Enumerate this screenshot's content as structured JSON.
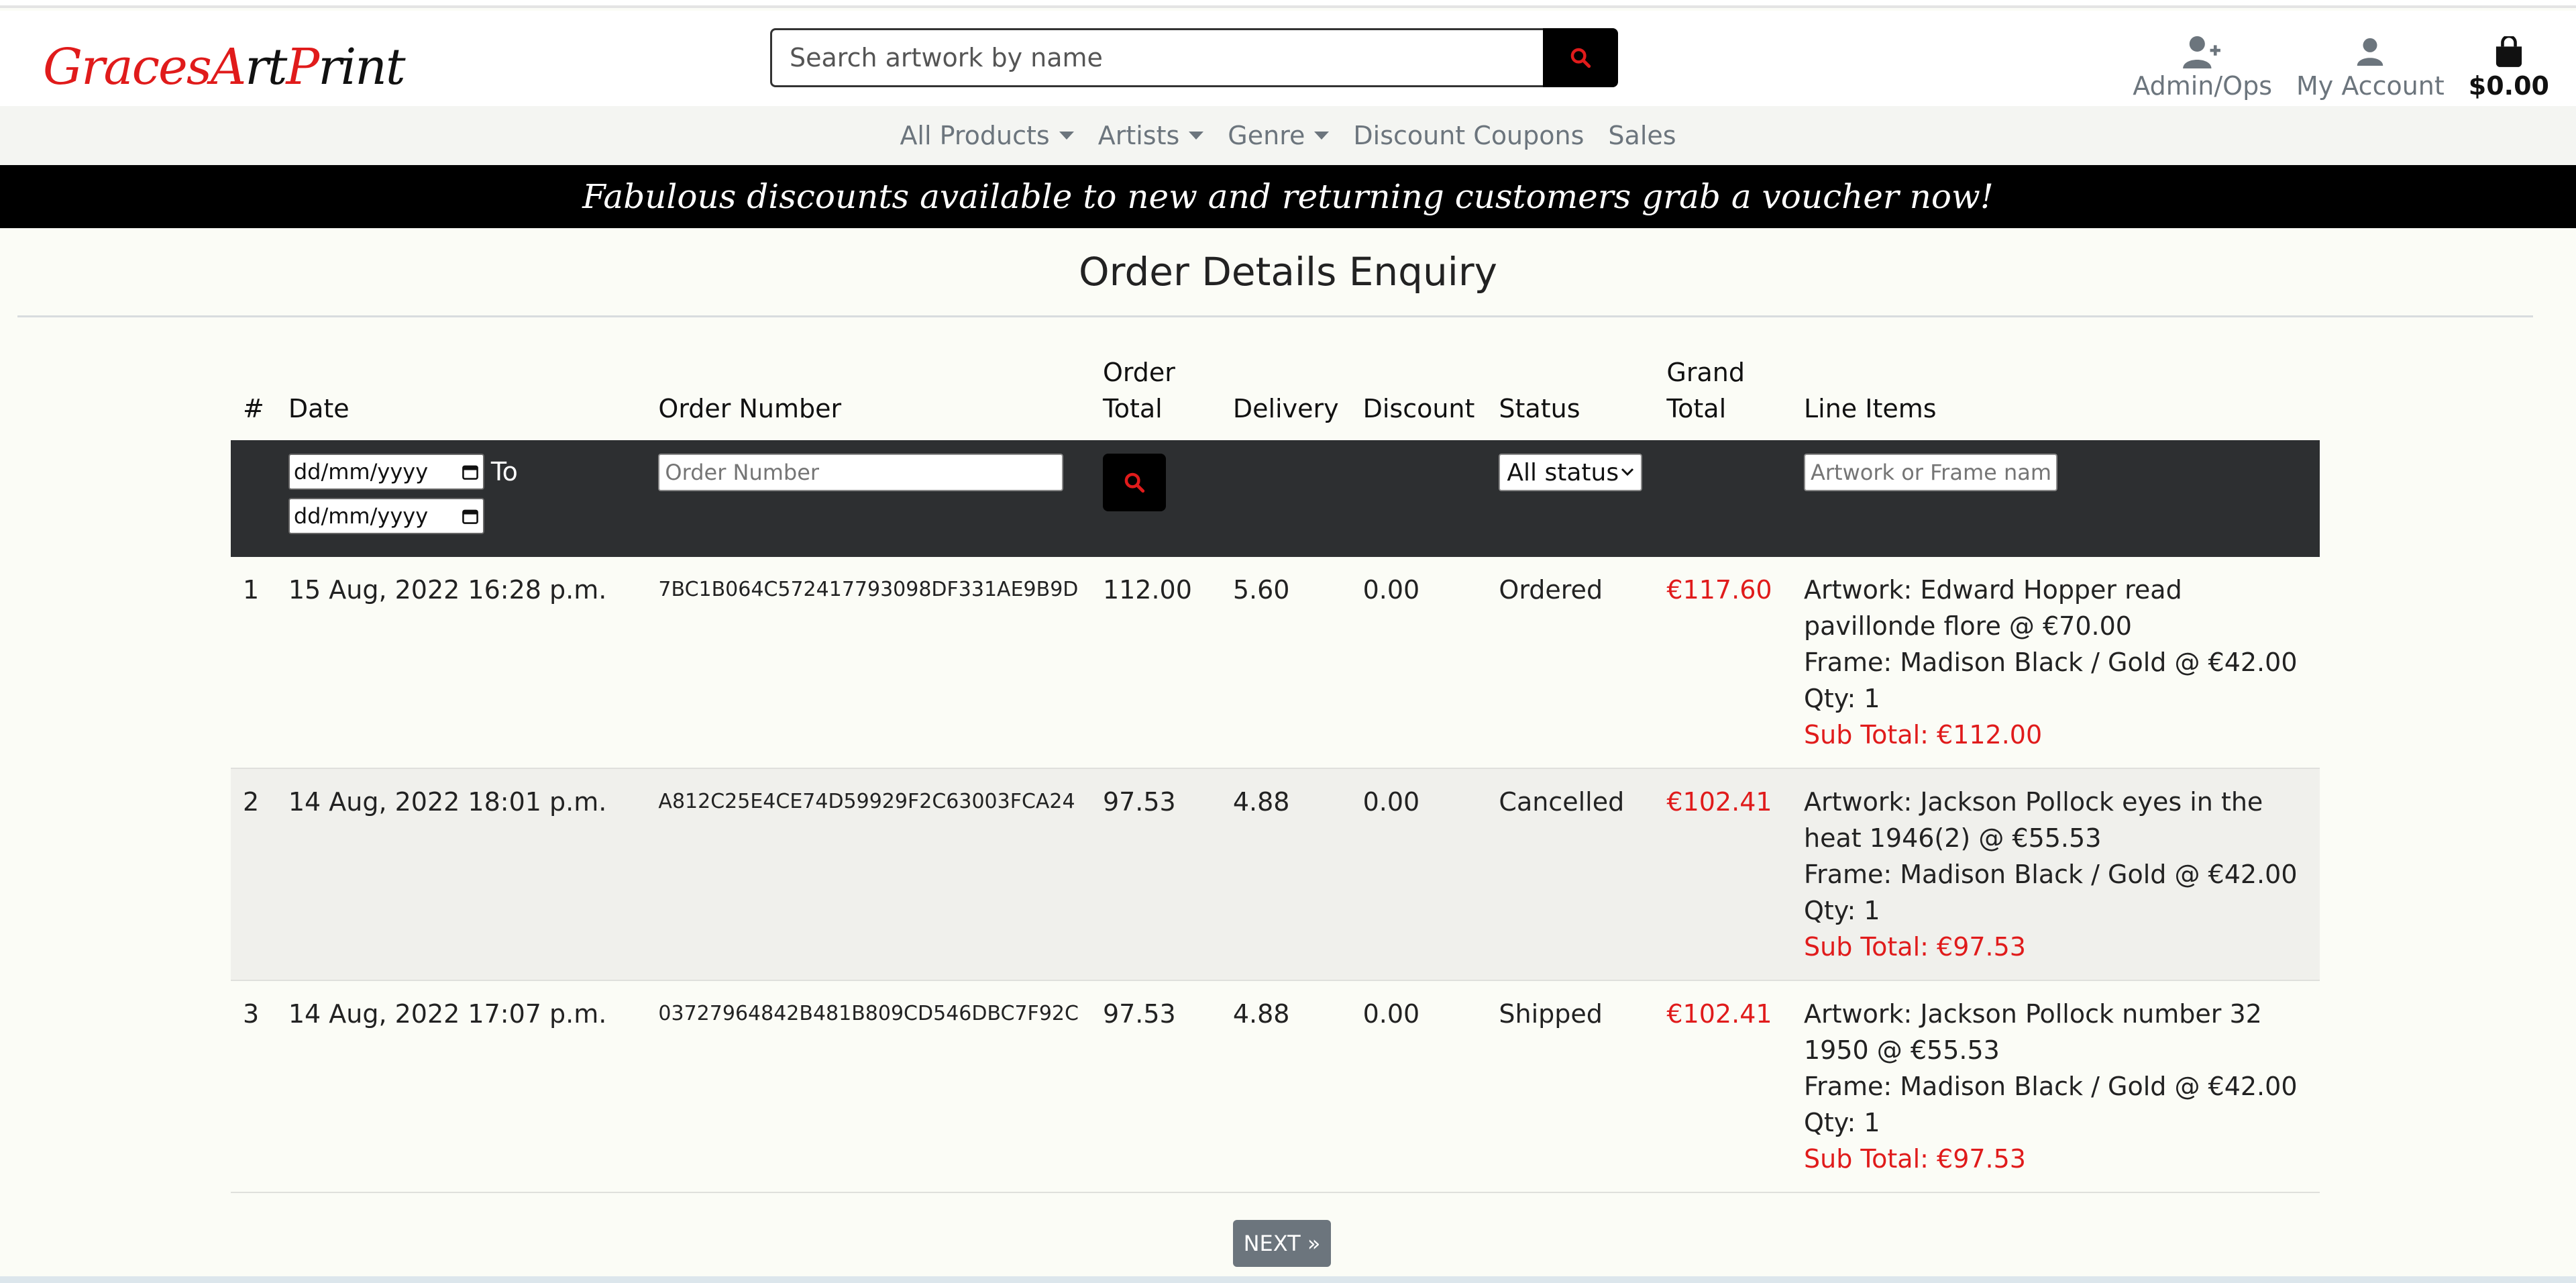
{
  "brand": {
    "part1": "Graces",
    "part2": "A",
    "part3": "rt",
    "part4": "P",
    "part5": "rint"
  },
  "search": {
    "placeholder": "Search artwork by name"
  },
  "header_links": {
    "admin": "Admin/Ops",
    "account": "My Account",
    "cart": "$0.00"
  },
  "nav": {
    "items": [
      {
        "label": "All Products",
        "dropdown": true
      },
      {
        "label": "Artists",
        "dropdown": true
      },
      {
        "label": "Genre",
        "dropdown": true
      },
      {
        "label": "Discount Coupons",
        "dropdown": false
      },
      {
        "label": "Sales",
        "dropdown": false
      }
    ]
  },
  "banner": {
    "text": "Fabulous discounts available to new and returning customers grab a voucher now!"
  },
  "page": {
    "title": "Order Details Enquiry"
  },
  "table": {
    "headers": {
      "num": "#",
      "date": "Date",
      "order_number": "Order Number",
      "order_total_1": "Order",
      "order_total_2": "Total",
      "delivery": "Delivery",
      "discount": "Discount",
      "status": "Status",
      "grand_total_1": "Grand",
      "grand_total_2": "Total",
      "line_items": "Line Items"
    },
    "filters": {
      "date_from": "dd/mm/yyyy",
      "to_label": "To",
      "date_to": "dd/mm/yyyy",
      "order_number_placeholder": "Order Number",
      "status_selected": "All status",
      "line_item_placeholder": "Artwork or Frame name"
    },
    "rows": [
      {
        "num": "1",
        "date": "15 Aug, 2022 16:28 p.m.",
        "order_number": "7BC1B064C572417793098DF331AE9B9D",
        "order_total": "112.00",
        "delivery": "5.60",
        "discount": "0.00",
        "status": "Ordered",
        "grand_total": "€117.60",
        "artwork": "Artwork: Edward Hopper read pavillonde flore @ €70.00",
        "frame": "Frame: Madison Black / Gold @ €42.00",
        "qty": "Qty: 1",
        "subtotal": "Sub Total: €112.00"
      },
      {
        "num": "2",
        "date": "14 Aug, 2022 18:01 p.m.",
        "order_number": "A812C25E4CE74D59929F2C63003FCA24",
        "order_total": "97.53",
        "delivery": "4.88",
        "discount": "0.00",
        "status": "Cancelled",
        "grand_total": "€102.41",
        "artwork": "Artwork: Jackson Pollock eyes in the heat 1946(2) @ €55.53",
        "frame": "Frame: Madison Black / Gold @ €42.00",
        "qty": "Qty: 1",
        "subtotal": "Sub Total: €97.53"
      },
      {
        "num": "3",
        "date": "14 Aug, 2022 17:07 p.m.",
        "order_number": "03727964842B481B809CD546DBC7F92C",
        "order_total": "97.53",
        "delivery": "4.88",
        "discount": "0.00",
        "status": "Shipped",
        "grand_total": "€102.41",
        "artwork": "Artwork: Jackson Pollock number 32 1950 @ €55.53",
        "frame": "Frame: Madison Black / Gold @ €42.00",
        "qty": "Qty: 1",
        "subtotal": "Sub Total: €97.53"
      }
    ]
  },
  "pager": {
    "next": "NEXT »"
  },
  "colors": {
    "accent": "#e01b1b",
    "banner_bg": "#000000",
    "filter_bg": "#2d2f31",
    "pager_bg": "#6c757d"
  }
}
